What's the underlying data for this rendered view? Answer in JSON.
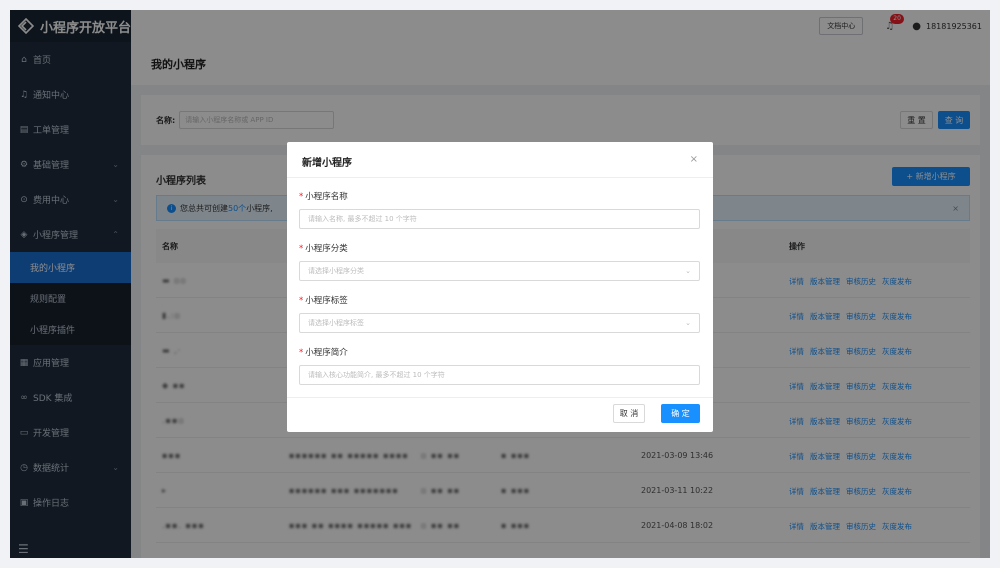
{
  "sidebar": {
    "logo_text": "小程序开放平台",
    "items": [
      {
        "icon": "⌂",
        "label": "首页"
      },
      {
        "icon": "♫",
        "label": "通知中心"
      },
      {
        "icon": "▤",
        "label": "工单管理"
      },
      {
        "icon": "⚙",
        "label": "基础管理",
        "chevron": "⌄"
      },
      {
        "icon": "⊙",
        "label": "费用中心",
        "chevron": "⌄"
      },
      {
        "icon": "◈",
        "label": "小程序管理",
        "chevron": "⌃"
      }
    ],
    "subitems": [
      "我的小程序",
      "规则配置",
      "小程序插件"
    ],
    "items2": [
      {
        "icon": "▦",
        "label": "应用管理"
      },
      {
        "icon": "∞",
        "label": "SDK 集成"
      },
      {
        "icon": "▭",
        "label": "开发管理"
      },
      {
        "icon": "◷",
        "label": "数据统计",
        "chevron": "⌄"
      },
      {
        "icon": "▣",
        "label": "操作日志"
      }
    ],
    "bottom_icon": "☰"
  },
  "topbar": {
    "doc_center": "文档中心",
    "badge": "20",
    "username": "18181925361"
  },
  "page": {
    "title": "我的小程序",
    "search_label": "名称:",
    "search_placeholder": "请输入小程序名称或 APP ID",
    "reset": "重 置",
    "query": "查 询",
    "list_title": "小程序列表",
    "add_button": "+ 新增小程序",
    "alert_prefix": "您总共可创建",
    "alert_count": "50个",
    "alert_suffix": "小程序,",
    "col_name": "名称",
    "col_ops": "操作",
    "ops": [
      "详情",
      "版本管理",
      "审核历史",
      "灰度发布"
    ],
    "rows": [
      {
        "name": "▬ ▫▫",
        "c1": "",
        "c2": "",
        "c3": "",
        "date": ""
      },
      {
        "name": "▮.:▫",
        "c1": "",
        "c2": "",
        "c3": "",
        "date": ""
      },
      {
        "name": "▬ ,·",
        "c1": "",
        "c2": "",
        "c3": "",
        "date": ""
      },
      {
        "name": "◆ ▪▪",
        "c1": "",
        "c2": "",
        "c3": "",
        "date": ""
      },
      {
        "name": ".▪▪▫",
        "c1": "",
        "c2": "",
        "c3": "",
        "date": ""
      },
      {
        "name": "▪▪▪",
        "c1": "▪▪▪▪▪▪ ▪▪ ▪▪▪▪▪ ▪▪▪▪",
        "c2": "▫ ▪▪ ▪▪",
        "c3": "▪ ▪▪▪",
        "date": "2021-03-09 13:46"
      },
      {
        "name": "▸",
        "c1": "▪▪▪▪▪▪ ▪▪▪ ▪▪▪▪▪▪▪",
        "c2": "▫ ▪▪ ▪▪",
        "c3": "▪ ▪▪▪",
        "date": "2021-03-11 10:22"
      },
      {
        "name": ".▪▪. ▪▪▪",
        "c1": "▪▪▪ ▪▪ ▪▪▪▪ ▪▪▪▪▪ ▪▪▪",
        "c2": "▫ ▪▪ ▪▪",
        "c3": "▪ ▪▪▪",
        "date": "2021-04-08 18:02"
      }
    ]
  },
  "modal": {
    "title": "新增小程序",
    "close": "×",
    "fields": [
      {
        "label": "小程序名称",
        "placeholder": "请输入名称, 最多不超过 10 个字符",
        "select": false
      },
      {
        "label": "小程序分类",
        "placeholder": "请选择小程序分类",
        "select": true
      },
      {
        "label": "小程序标签",
        "placeholder": "请选择小程序标签",
        "select": true
      },
      {
        "label": "小程序简介",
        "placeholder": "请输入核心功能简介, 最多不超过 10 个字符",
        "select": false
      }
    ],
    "required_mark": "*",
    "select_chevron": "⌄",
    "cancel": "取 消",
    "ok": "确 定"
  },
  "colors": {
    "primary": "#1890ff",
    "sidebar": "#1f2d3d",
    "active": "#1b6fd4"
  }
}
